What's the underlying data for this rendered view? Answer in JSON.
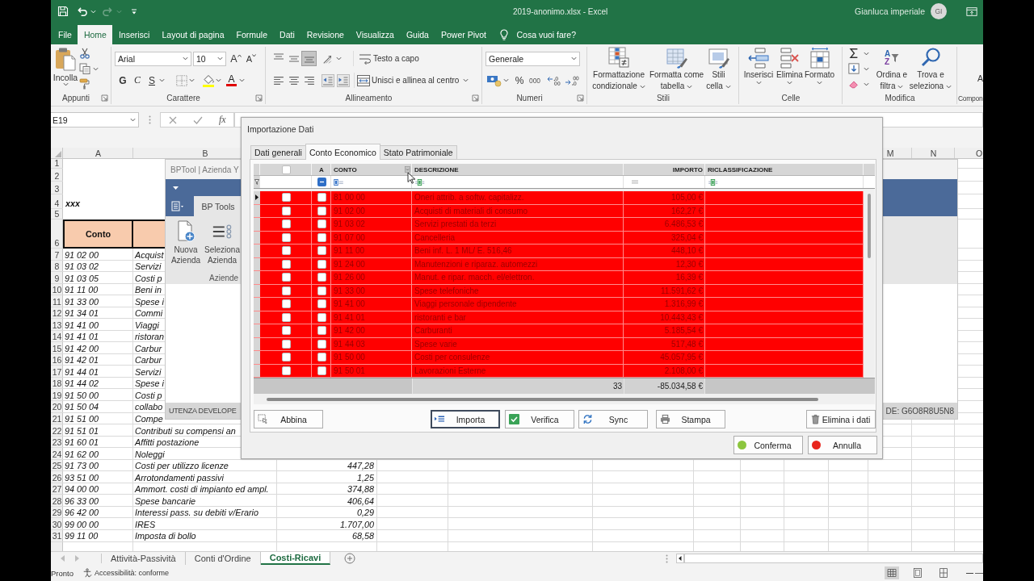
{
  "title_bar": {
    "quick_access": [
      {
        "kind": "save",
        "disabled": false
      },
      {
        "kind": "undo",
        "disabled": false
      },
      {
        "kind": "redo",
        "disabled": true
      },
      {
        "kind": "customize",
        "disabled": false
      }
    ],
    "title": "2019-anonimo.xlsx - Excel",
    "user_name": "Gianluca imperiale",
    "user_initials": "GI"
  },
  "ribbon_tabs": [
    {
      "label": "File",
      "selected": false
    },
    {
      "label": "Home",
      "selected": true
    },
    {
      "label": "Inserisci",
      "selected": false
    },
    {
      "label": "Layout di pagina",
      "selected": false
    },
    {
      "label": "Formule",
      "selected": false
    },
    {
      "label": "Dati",
      "selected": false
    },
    {
      "label": "Revisione",
      "selected": false
    },
    {
      "label": "Visualizza",
      "selected": false
    },
    {
      "label": "Guida",
      "selected": false
    },
    {
      "label": "Power Pivot",
      "selected": false
    }
  ],
  "tell_me": "Cosa vuoi fare?",
  "ribbon": {
    "appunti": {
      "label": "Appunti",
      "paste": "Incolla"
    },
    "carattere": {
      "label": "Carattere",
      "font": "Arial",
      "size": "10",
      "grow": "A",
      "shrink": "A",
      "bold": "G",
      "italic": "C",
      "underline": "S",
      "font_color": "A"
    },
    "allineamento": {
      "label": "Allineamento",
      "vertical": [
        {
          "kind": "top",
          "selected": false
        },
        {
          "kind": "middle",
          "selected": false
        },
        {
          "kind": "bottom",
          "selected": true
        }
      ],
      "wrap": "Testo a capo",
      "merge": "Unisci e allinea al centro"
    },
    "numeri": {
      "label": "Numeri",
      "format": "Generale",
      "percent": "%",
      "thousands": "000"
    },
    "stili": {
      "label": "Stili",
      "buttons": [
        {
          "kind": "conditional",
          "lines": [
            "Formattazione",
            "condizionale"
          ]
        },
        {
          "kind": "table",
          "lines": [
            "Formatta come",
            "tabella"
          ]
        },
        {
          "kind": "cell_styles",
          "lines": [
            "Stili",
            "cella"
          ]
        }
      ]
    },
    "celle": {
      "label": "Celle",
      "buttons": [
        {
          "kind": "insert",
          "label": "Inserisci"
        },
        {
          "kind": "delete",
          "label": "Elimina"
        },
        {
          "kind": "format",
          "label": "Formato"
        }
      ]
    },
    "modifica": {
      "label": "Modifica",
      "buttons": [
        {
          "kind": "sort",
          "icon_letters": [
            "A",
            "Z"
          ],
          "lines": [
            "Ordina e",
            "filtra"
          ]
        },
        {
          "kind": "find",
          "lines": [
            "Trova e",
            "seleziona"
          ]
        }
      ]
    },
    "componenti": {
      "label": "Compon",
      "button": "A"
    }
  },
  "formula_bar": {
    "name_box": "E19",
    "function_label": "fx"
  },
  "sheet": {
    "column_headers": [
      "A",
      "B",
      "M",
      "N",
      "O"
    ],
    "rows": [
      {
        "number": "1",
        "kind": "blank"
      },
      {
        "number": "2",
        "kind": "blank"
      },
      {
        "number": "3",
        "kind": "blank"
      },
      {
        "number": "4",
        "kind": "title",
        "a": "xxx"
      },
      {
        "number": "5",
        "kind": "blank"
      },
      {
        "number": "6",
        "kind": "header",
        "a": "Conto"
      },
      {
        "number": "7",
        "kind": "data",
        "a": "91 02 00",
        "b": "Acquist"
      },
      {
        "number": "8",
        "kind": "data",
        "a": "91 03 02",
        "b": "Servizi"
      },
      {
        "number": "9",
        "kind": "data",
        "a": "91 03 05",
        "b": "Costi p"
      },
      {
        "number": "10",
        "kind": "data",
        "a": "91 11 00",
        "b": "Beni in"
      },
      {
        "number": "11",
        "kind": "data",
        "a": "91 33 00",
        "b": "Spese i"
      },
      {
        "number": "12",
        "kind": "data",
        "a": "91 34 01",
        "b": "Commi"
      },
      {
        "number": "13",
        "kind": "data",
        "a": "91 41 00",
        "b": "Viaggi"
      },
      {
        "number": "14",
        "kind": "data",
        "a": "91 41 01",
        "b": "ristoran"
      },
      {
        "number": "15",
        "kind": "data",
        "a": "91 42 00",
        "b": "Carbur"
      },
      {
        "number": "16",
        "kind": "data",
        "a": "91 42 01",
        "b": "Carbur"
      },
      {
        "number": "17",
        "kind": "data",
        "a": "91 44 01",
        "b": "Servizi"
      },
      {
        "number": "18",
        "kind": "data",
        "a": "91 44 02",
        "b": "Spese i"
      },
      {
        "number": "19",
        "kind": "data",
        "a": "91 50 00",
        "b": "Costi p"
      },
      {
        "number": "20",
        "kind": "data",
        "a": "91 50 04",
        "b": "collabo"
      },
      {
        "number": "21",
        "kind": "data",
        "a": "91 51 00",
        "b": "Compe"
      },
      {
        "number": "22",
        "kind": "data",
        "a": "91 51 01",
        "b": "Contributi su compensi an"
      },
      {
        "number": "23",
        "kind": "data",
        "a": "91 60 01",
        "b": "Affitti postazione"
      },
      {
        "number": "24",
        "kind": "data",
        "a": "91 62 00",
        "b": "Noleggi"
      },
      {
        "number": "25",
        "kind": "data",
        "a": "91 73 00",
        "b": "Costi per utilizzo licenze",
        "c": "447,28"
      },
      {
        "number": "26",
        "kind": "data",
        "a": "93 51 00",
        "b": "Arrotondamenti passivi",
        "c": "1,25"
      },
      {
        "number": "27",
        "kind": "data",
        "a": "94 00 00",
        "b": "Ammort. costi di impianto ed ampl.",
        "c": "374,88"
      },
      {
        "number": "28",
        "kind": "data",
        "a": "96 33 00",
        "b": "Spese bancarie",
        "c": "406,64"
      },
      {
        "number": "29",
        "kind": "data",
        "a": "96 42 00",
        "b": "Interessi pass. su debiti v/Erario",
        "c": "0,29"
      },
      {
        "number": "30",
        "kind": "data",
        "a": "99 00 00",
        "b": "IRES",
        "c": "1.707,00"
      },
      {
        "number": "31",
        "kind": "data",
        "a": "99 11 00",
        "b": "Imposta di bollo",
        "c": "68,58"
      }
    ]
  },
  "bptool_window": {
    "title": "BPTool | Azienda Y",
    "tab": "BP Tools",
    "buttons": [
      {
        "kind": "new",
        "lines": [
          "Nuova",
          "Azienda"
        ]
      },
      {
        "kind": "select",
        "lines": [
          "Seleziona",
          "Azienda"
        ]
      }
    ],
    "group_label": "Aziende",
    "status_left": "UTENZA DEVELOPE",
    "status_right": "DE: G6O8R8U5N8"
  },
  "dialog": {
    "title": "Importazione Dati",
    "tabs": [
      {
        "label": "Dati generali",
        "selected": false
      },
      {
        "label": "Conto Economico",
        "selected": true
      },
      {
        "label": "Stato Patrimoniale",
        "selected": false
      }
    ],
    "grid": {
      "header_checked": false,
      "columns": [
        "A",
        "CONTO",
        "DESCRIZIONE",
        "IMPORTO",
        "RICLASSIFICAZIONE"
      ],
      "rows": [
        {
          "current": true,
          "highlighted": true,
          "checked": false,
          "a_checked": false,
          "conto": "81 00 00",
          "descrizione": "Oneri attrib. a softw. capitalizz.",
          "importo": "105,00 €"
        },
        {
          "current": false,
          "highlighted": true,
          "checked": false,
          "a_checked": false,
          "conto": "91 02 00",
          "descrizione": "Acquisti di materiali di consumo",
          "importo": "162,27 €"
        },
        {
          "current": false,
          "highlighted": true,
          "checked": false,
          "a_checked": false,
          "conto": "91 03 02",
          "descrizione": "Servizi prestati da terzi",
          "importo": "6.486,53 €"
        },
        {
          "current": false,
          "highlighted": true,
          "checked": false,
          "a_checked": false,
          "conto": "91 07 00",
          "descrizione": "Cancelleria",
          "importo": "325,04 €"
        },
        {
          "current": false,
          "highlighted": true,
          "checked": false,
          "a_checked": false,
          "conto": "91 11 00",
          "descrizione": "Beni inf. L. 1 ML/ E. 516,46",
          "importo": "448,10 €"
        },
        {
          "current": false,
          "highlighted": true,
          "checked": false,
          "a_checked": false,
          "conto": "91 24 00",
          "descrizione": "Manutenzioni e riparaz. automezzi",
          "importo": "12,30 €"
        },
        {
          "current": false,
          "highlighted": true,
          "checked": false,
          "a_checked": false,
          "conto": "91 26 00",
          "descrizione": "Manut. e ripar. macch. el/elettron.",
          "importo": "16,39 €"
        },
        {
          "current": false,
          "highlighted": true,
          "checked": false,
          "a_checked": false,
          "conto": "91 33 00",
          "descrizione": "Spese telefoniche",
          "importo": "11.591,62 €"
        },
        {
          "current": false,
          "highlighted": true,
          "checked": false,
          "a_checked": false,
          "conto": "91 41 00",
          "descrizione": "Viaggi personale dipendente",
          "importo": "1.316,99 €"
        },
        {
          "current": false,
          "highlighted": true,
          "checked": false,
          "a_checked": false,
          "conto": "91 41 01",
          "descrizione": "ristoranti e bar",
          "importo": "10.443,43 €"
        },
        {
          "current": false,
          "highlighted": true,
          "checked": false,
          "a_checked": false,
          "conto": "91 42 00",
          "descrizione": "Carburanti",
          "importo": "5.185,54 €"
        },
        {
          "current": false,
          "highlighted": true,
          "checked": false,
          "a_checked": false,
          "conto": "91 44 03",
          "descrizione": "Spese varie",
          "importo": "517,48 €"
        },
        {
          "current": false,
          "highlighted": true,
          "checked": false,
          "a_checked": false,
          "conto": "91 50 00",
          "descrizione": "Costi per consulenze",
          "importo": "45.057,95 €"
        },
        {
          "current": false,
          "highlighted": true,
          "checked": false,
          "a_checked": false,
          "conto": "91 50 01",
          "descrizione": "Lavorazioni Esterne",
          "importo": "2.108,00 €"
        }
      ],
      "footer": {
        "count": "33",
        "total": "-85.034,58 €"
      }
    },
    "action_buttons": [
      {
        "kind": "match",
        "label": "Abbina",
        "focused": false
      },
      {
        "kind": "import",
        "label": "Importa",
        "focused": true
      },
      {
        "kind": "verify",
        "label": "Verifica",
        "focused": false
      },
      {
        "kind": "sync",
        "label": "Sync",
        "focused": false
      },
      {
        "kind": "print",
        "label": "Stampa",
        "focused": false
      },
      {
        "kind": "delete",
        "label": "Elimina i dati",
        "focused": false
      }
    ],
    "confirm_buttons": [
      {
        "label": "Conferma",
        "color": "#8cc63e"
      },
      {
        "label": "Annulla",
        "color": "#e8251c"
      }
    ]
  },
  "sheet_tabs": [
    {
      "label": "Attività-Passività",
      "selected": false
    },
    {
      "label": "Conti d'Ordine",
      "selected": false
    },
    {
      "label": "Costi-Ricavi",
      "selected": true
    }
  ],
  "status_bar": {
    "ready": "Pronto",
    "accessibility": "Accessibilità: conforme",
    "views": [
      {
        "kind": "normal",
        "selected": true
      },
      {
        "kind": "page_layout",
        "selected": false
      },
      {
        "kind": "page_break",
        "selected": false
      }
    ]
  }
}
